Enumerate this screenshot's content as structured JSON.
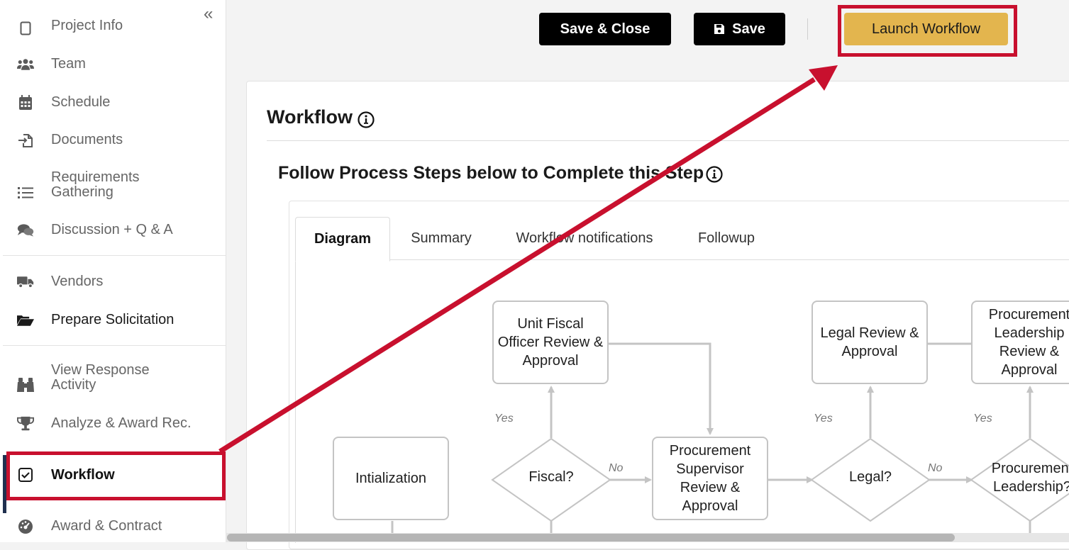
{
  "sidebar": {
    "collapse_glyph": "«",
    "items": [
      {
        "label": "Project Info",
        "icon": "file-icon"
      },
      {
        "label": "Team",
        "icon": "users-icon"
      },
      {
        "label": "Schedule",
        "icon": "calendar-icon"
      },
      {
        "label": "Documents",
        "icon": "file-import-icon"
      },
      {
        "label": "Requirements\nGathering",
        "icon": "list-icon"
      },
      {
        "label": "Discussion + Q & A",
        "icon": "comments-icon"
      },
      {
        "label": "Vendors",
        "icon": "truck-icon"
      },
      {
        "label": "Prepare Solicitation",
        "icon": "folder-open-icon"
      },
      {
        "label": "View Response\nActivity",
        "icon": "binoculars-icon"
      },
      {
        "label": "Analyze & Award Rec.",
        "icon": "trophy-icon"
      },
      {
        "label": "Workflow",
        "icon": "check-square-icon",
        "active": true
      },
      {
        "label": "Award & Contract",
        "icon": "dashboard-icon"
      }
    ]
  },
  "toolbar": {
    "save_close_label": "Save & Close",
    "save_label": "Save",
    "launch_label": "Launch Workflow"
  },
  "main": {
    "title": "Workflow",
    "subtitle": "Follow Process Steps below to Complete this Step",
    "tabs": [
      {
        "label": "Diagram",
        "active": true
      },
      {
        "label": "Summary"
      },
      {
        "label": "Workflow notifications"
      },
      {
        "label": "Followup"
      }
    ]
  },
  "diagram": {
    "nodes": {
      "init": "Intialization",
      "fiscal_review": "Unit Fiscal\nOfficer Review &\nApproval",
      "fiscal_q": "Fiscal?",
      "proc_sup": "Procurement\nSupervisor\nReview &\nApproval",
      "legal_review": "Legal Review &\nApproval",
      "legal_q": "Legal?",
      "proc_lead": "Procurement\nLeadership\nReview &\nApproval",
      "proc_lead_q": "Procurement\nLeadership?"
    },
    "labels": {
      "yes": "Yes",
      "no": "No"
    }
  },
  "colors": {
    "accent_red": "#c8102e",
    "gold_button": "#e3b54e",
    "dark_button": "#000000",
    "node_border": "#c4c4c4",
    "active_bar": "#20304f"
  }
}
